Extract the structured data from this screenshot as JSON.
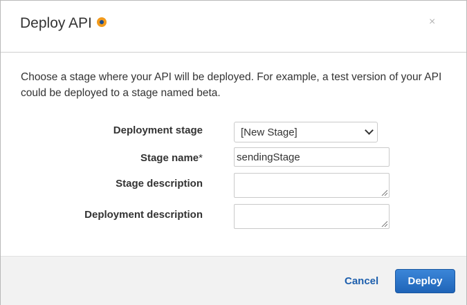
{
  "header": {
    "title": "Deploy API",
    "close_label": "×"
  },
  "intro_text": "Choose a stage where your API will be deployed. For example, a test version of your API could be deployed to a stage named beta.",
  "form": {
    "deployment_stage": {
      "label": "Deployment stage",
      "value": "[New Stage]"
    },
    "stage_name": {
      "label": "Stage name",
      "required_mark": "*",
      "value": "sendingStage"
    },
    "stage_description": {
      "label": "Stage description",
      "value": ""
    },
    "deployment_description": {
      "label": "Deployment description",
      "value": ""
    }
  },
  "footer": {
    "cancel_label": "Cancel",
    "deploy_label": "Deploy"
  },
  "colors": {
    "primary_button": "#1f64b8",
    "link": "#1d5fad",
    "help_icon": "#f29b1d"
  }
}
